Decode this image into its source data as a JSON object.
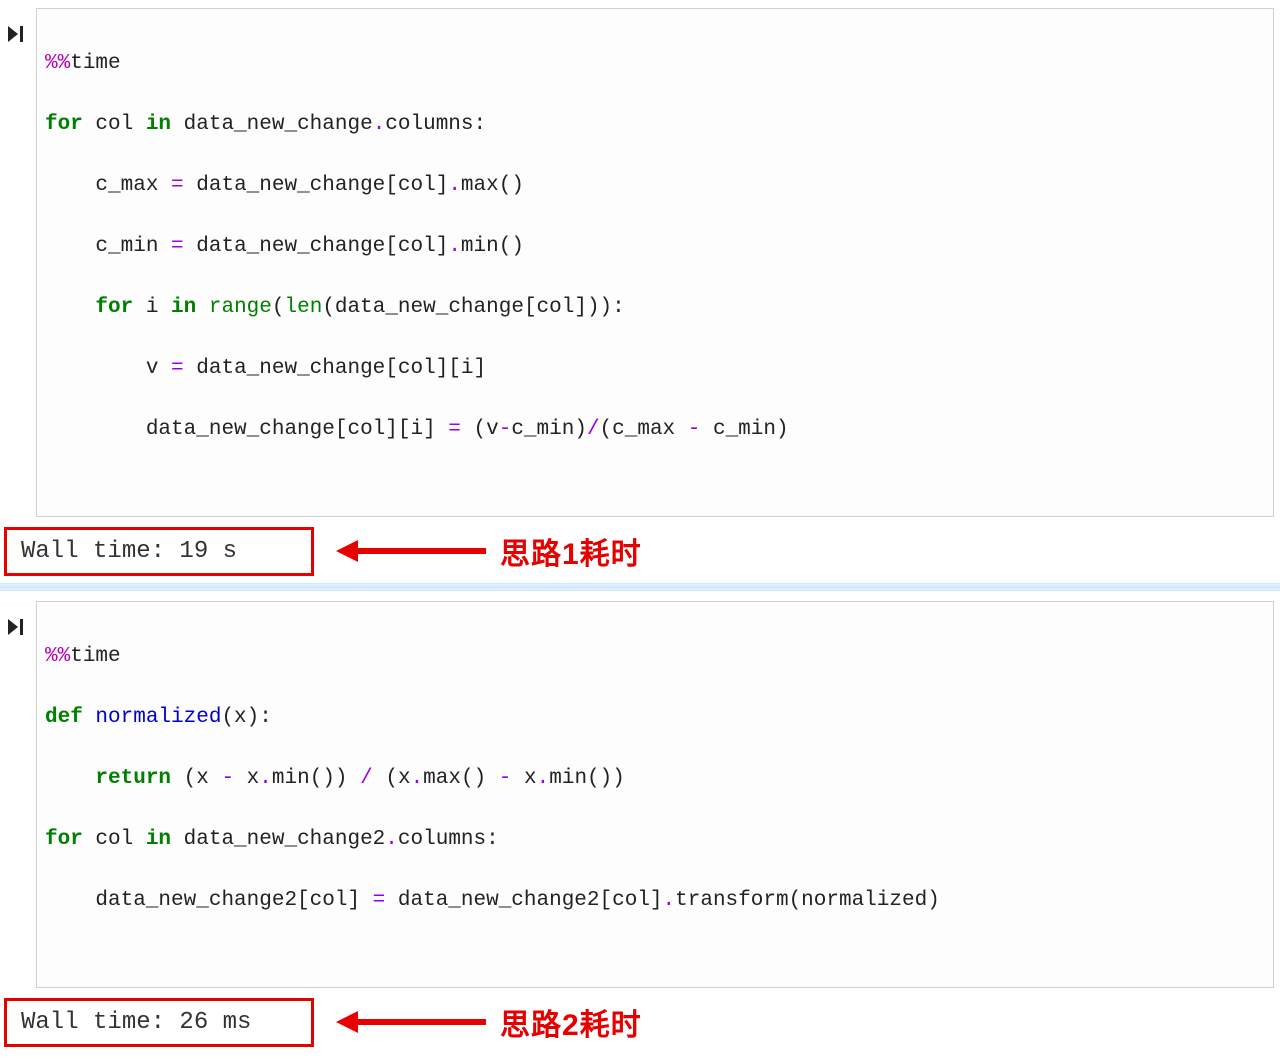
{
  "run_icon_glyph": "▶|",
  "cell1": {
    "code": {
      "l1": {
        "magic": "%%",
        "rest": "time"
      },
      "l2": {
        "kw1": "for",
        "v1": " col ",
        "kw2": "in",
        "v2": " data_new_change",
        "punc1": ".",
        "v3": "columns",
        "punc2": ":"
      },
      "l3": {
        "indent": "    ",
        "v1": "c_max ",
        "op": "=",
        "v2": " data_new_change[col]",
        "punc1": ".",
        "call": "max",
        "rest": "()"
      },
      "l4": {
        "indent": "    ",
        "v1": "c_min ",
        "op": "=",
        "v2": " data_new_change[col]",
        "punc1": ".",
        "call": "min",
        "rest": "()"
      },
      "l5": {
        "indent": "    ",
        "kw1": "for",
        "v1": " i ",
        "kw2": "in",
        "sp": " ",
        "builtin1": "range",
        "p1": "(",
        "builtin2": "len",
        "rest": "(data_new_change[col])):"
      },
      "l6": {
        "indent": "        ",
        "v1": "v ",
        "op": "=",
        "rest": " data_new_change[col][i]"
      },
      "l7": {
        "indent": "        ",
        "lhs": "data_new_change[col][i] ",
        "op1": "=",
        "mid": " (v",
        "op2": "-",
        "v2": "c_min)",
        "op3": "/",
        "v3": "(c_max ",
        "op4": "-",
        "rest": " c_min)"
      }
    },
    "walltime": "Wall time: 19 s",
    "label": "思路1耗时"
  },
  "cell2": {
    "code": {
      "l1": {
        "magic": "%%",
        "rest": "time"
      },
      "l2": {
        "kw": "def",
        "sp": " ",
        "fn": "normalized",
        "rest": "(x):"
      },
      "l3": {
        "indent": "    ",
        "kw": "return",
        "mid1": " (x ",
        "op1": "-",
        "mid2": " x",
        "punc1": ".",
        "call1": "min",
        "mid3": "()) ",
        "op2": "/",
        "mid4": " (x",
        "punc2": ".",
        "call2": "max",
        "mid5": "() ",
        "op3": "-",
        "mid6": " x",
        "punc3": ".",
        "call3": "min",
        "rest": "())"
      },
      "l4": {
        "kw1": "for",
        "v1": " col ",
        "kw2": "in",
        "v2": " data_new_change2",
        "punc1": ".",
        "v3": "columns",
        "punc2": ":"
      },
      "l5": {
        "indent": "    ",
        "lhs": "data_new_change2[col] ",
        "op": "=",
        "mid1": " data_new_change2[col]",
        "punc1": ".",
        "call": "transform",
        "p": "(",
        "arg": "normalized",
        "rest": ")"
      }
    },
    "walltime": "Wall time: 26 ms",
    "label": "思路2耗时"
  },
  "colors": {
    "annotation_red": "#e60000"
  }
}
